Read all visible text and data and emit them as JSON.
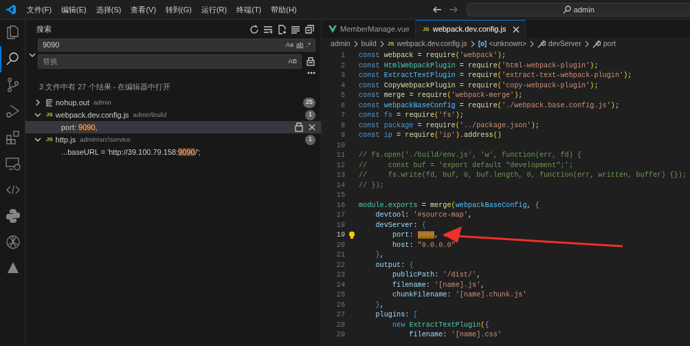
{
  "menu": [
    "文件(F)",
    "编辑(E)",
    "选择(S)",
    "查看(V)",
    "转到(G)",
    "运行(R)",
    "终端(T)",
    "帮助(H)"
  ],
  "command_center": {
    "value": "admin"
  },
  "activity_bar": [
    {
      "selected": false
    },
    {
      "selected": true
    },
    {
      "selected": false
    },
    {
      "selected": false
    },
    {
      "selected": false
    },
    {
      "selected": false
    },
    {
      "selected": false
    },
    {
      "selected": false
    },
    {
      "selected": false
    },
    {
      "selected": false
    }
  ],
  "sidebar": {
    "title": "搜索",
    "search": {
      "value": "9090",
      "options": [
        "Aa",
        "ab",
        ".*"
      ]
    },
    "replace_expanded": true,
    "replace": {
      "placeholder": "替换",
      "option": "AB"
    },
    "summary": "3 文件中有 27 个结果 - ",
    "summary_link": "在编辑器中打开",
    "results": [
      {
        "kind": "text",
        "name": "nohup.out",
        "path": "admin",
        "count": "25",
        "expanded": false
      },
      {
        "kind": "js",
        "badge": "JS",
        "name": "webpack.dev.config.js",
        "path": "admin\\build",
        "count": "1",
        "expanded": true,
        "children": [
          {
            "before": "port: ",
            "match": "9090",
            "after": ",",
            "selected": true
          }
        ]
      },
      {
        "kind": "js",
        "badge": "JS",
        "name": "http.js",
        "path": "admin\\src\\service",
        "count": "1",
        "expanded": true,
        "children": [
          {
            "before": "...baseURL = 'http://39.100.79.158:",
            "match": "9090",
            "after": "/';",
            "selected": false
          }
        ]
      }
    ]
  },
  "tabs": [
    {
      "kind": "vue",
      "label": "MemberManage.vue",
      "selected": false
    },
    {
      "kind": "js",
      "badge": "JS",
      "label": "webpack.dev.config.js",
      "selected": true
    }
  ],
  "breadcrumb": [
    {
      "kind": "folder",
      "label": "admin"
    },
    {
      "kind": "folder",
      "label": "build"
    },
    {
      "kind": "js",
      "badge": "JS",
      "label": "webpack.dev.config.js"
    },
    {
      "kind": "object",
      "label": "<unknown>"
    },
    {
      "kind": "property",
      "label": "devServer"
    },
    {
      "kind": "property",
      "label": "port"
    }
  ],
  "editor": {
    "lines": [
      {
        "number": "1",
        "current": false,
        "tokens": [
          {
            "text": "const ",
            "kind": "kw"
          },
          {
            "text": "webpack",
            "kind": "plain"
          },
          {
            "text": " = ",
            "kind": "punct"
          },
          {
            "text": "require",
            "kind": "func"
          },
          {
            "text": "(",
            "kind": "br1"
          },
          {
            "text": "'webpack'",
            "kind": "str"
          },
          {
            "text": ")",
            "kind": "br1"
          },
          {
            "text": ";",
            "kind": "punct"
          }
        ]
      },
      {
        "number": "2",
        "current": false,
        "tokens": [
          {
            "text": "const ",
            "kind": "kw"
          },
          {
            "text": "HtmlWebpackPlugin",
            "kind": "class"
          },
          {
            "text": " = ",
            "kind": "punct"
          },
          {
            "text": "require",
            "kind": "func"
          },
          {
            "text": "(",
            "kind": "br1"
          },
          {
            "text": "'html-webpack-plugin'",
            "kind": "str"
          },
          {
            "text": ")",
            "kind": "br1"
          },
          {
            "text": ";",
            "kind": "punct"
          }
        ]
      },
      {
        "number": "3",
        "current": false,
        "tokens": [
          {
            "text": "const ",
            "kind": "kw"
          },
          {
            "text": "ExtractTextPlugin",
            "kind": "const"
          },
          {
            "text": " = ",
            "kind": "punct"
          },
          {
            "text": "require",
            "kind": "func"
          },
          {
            "text": "(",
            "kind": "br1"
          },
          {
            "text": "'extract-text-webpack-plugin'",
            "kind": "str"
          },
          {
            "text": ")",
            "kind": "br1"
          },
          {
            "text": ";",
            "kind": "punct"
          }
        ]
      },
      {
        "number": "4",
        "current": false,
        "tokens": [
          {
            "text": "const ",
            "kind": "kw"
          },
          {
            "text": "CopyWebpackPlugin",
            "kind": "plain"
          },
          {
            "text": " = ",
            "kind": "punct"
          },
          {
            "text": "require",
            "kind": "func"
          },
          {
            "text": "(",
            "kind": "br1"
          },
          {
            "text": "'copy-webpack-plugin'",
            "kind": "str"
          },
          {
            "text": ")",
            "kind": "br1"
          },
          {
            "text": ";",
            "kind": "punct"
          }
        ]
      },
      {
        "number": "5",
        "current": false,
        "tokens": [
          {
            "text": "const ",
            "kind": "kw"
          },
          {
            "text": "merge",
            "kind": "plain"
          },
          {
            "text": " = ",
            "kind": "punct"
          },
          {
            "text": "require",
            "kind": "func"
          },
          {
            "text": "(",
            "kind": "br1"
          },
          {
            "text": "'webpack-merge'",
            "kind": "str"
          },
          {
            "text": ")",
            "kind": "br1"
          },
          {
            "text": ";",
            "kind": "punct"
          }
        ]
      },
      {
        "number": "6",
        "current": false,
        "tokens": [
          {
            "text": "const ",
            "kind": "kw"
          },
          {
            "text": "webpackBaseConfig",
            "kind": "const"
          },
          {
            "text": " = ",
            "kind": "punct"
          },
          {
            "text": "require",
            "kind": "func"
          },
          {
            "text": "(",
            "kind": "br1"
          },
          {
            "text": "'./webpack.base.config.js'",
            "kind": "str"
          },
          {
            "text": ")",
            "kind": "br1"
          },
          {
            "text": ";",
            "kind": "punct"
          }
        ]
      },
      {
        "number": "7",
        "current": false,
        "tokens": [
          {
            "text": "const ",
            "kind": "kw"
          },
          {
            "text": "fs",
            "kind": "var"
          },
          {
            "text": " = ",
            "kind": "punct"
          },
          {
            "text": "require",
            "kind": "func"
          },
          {
            "text": "(",
            "kind": "br1"
          },
          {
            "text": "'fs'",
            "kind": "str"
          },
          {
            "text": ")",
            "kind": "br1"
          },
          {
            "text": ";",
            "kind": "punct"
          }
        ]
      },
      {
        "number": "8",
        "current": false,
        "tokens": [
          {
            "text": "const ",
            "kind": "kw"
          },
          {
            "text": "package",
            "kind": "var"
          },
          {
            "text": " = ",
            "kind": "punct"
          },
          {
            "text": "require",
            "kind": "func"
          },
          {
            "text": "(",
            "kind": "br1"
          },
          {
            "text": "'../package.json'",
            "kind": "str"
          },
          {
            "text": ")",
            "kind": "br1"
          },
          {
            "text": ";",
            "kind": "punct"
          }
        ]
      },
      {
        "number": "9",
        "current": false,
        "tokens": [
          {
            "text": "const ",
            "kind": "kw"
          },
          {
            "text": "ip",
            "kind": "var"
          },
          {
            "text": " = ",
            "kind": "punct"
          },
          {
            "text": "require",
            "kind": "func"
          },
          {
            "text": "(",
            "kind": "br1"
          },
          {
            "text": "'ip'",
            "kind": "str"
          },
          {
            "text": ")",
            "kind": "br1"
          },
          {
            "text": ".",
            "kind": "punct"
          },
          {
            "text": "address",
            "kind": "func"
          },
          {
            "text": "()",
            "kind": "br1"
          }
        ]
      },
      {
        "number": "10",
        "current": false
      },
      {
        "number": "11",
        "current": false,
        "tokens": [
          {
            "text": "// fs.open('./build/env.js', 'w', function(err, fd) {",
            "kind": "comment"
          }
        ]
      },
      {
        "number": "12",
        "current": false,
        "tokens": [
          {
            "text": "//     const buf = 'export default \"development\";';",
            "kind": "comment"
          }
        ]
      },
      {
        "number": "13",
        "current": false,
        "tokens": [
          {
            "text": "//     fs.write(fd, buf, 0, buf.length, 0, function(err, written, buffer) {});",
            "kind": "comment"
          }
        ]
      },
      {
        "number": "14",
        "current": false,
        "tokens": [
          {
            "text": "// });",
            "kind": "comment"
          }
        ]
      },
      {
        "number": "15",
        "current": false
      },
      {
        "number": "16",
        "current": false,
        "tokens": [
          {
            "text": "module",
            "kind": "class"
          },
          {
            "text": ".",
            "kind": "punct"
          },
          {
            "text": "exports",
            "kind": "class"
          },
          {
            "text": " = ",
            "kind": "punct"
          },
          {
            "text": "merge",
            "kind": "func"
          },
          {
            "text": "(",
            "kind": "br1"
          },
          {
            "text": "webpackBaseConfig",
            "kind": "const"
          },
          {
            "text": ", ",
            "kind": "punct"
          },
          {
            "text": "{",
            "kind": "br2"
          }
        ]
      },
      {
        "number": "17",
        "current": false,
        "tokens": [
          {
            "text": "    devtool",
            "kind": "prop"
          },
          {
            "text": ": ",
            "kind": "punct"
          },
          {
            "text": "'#source-map'",
            "kind": "str"
          },
          {
            "text": ",",
            "kind": "punct"
          }
        ]
      },
      {
        "number": "18",
        "current": false,
        "tokens": [
          {
            "text": "    devServer",
            "kind": "prop"
          },
          {
            "text": ": ",
            "kind": "punct"
          },
          {
            "text": "{",
            "kind": "br3"
          }
        ]
      },
      {
        "number": "19",
        "current": true,
        "tokens": [
          {
            "text": "        port",
            "kind": "prop"
          },
          {
            "text": ": ",
            "kind": "punct"
          },
          {
            "text": "9090",
            "kind": "match"
          },
          {
            "text": ",",
            "kind": "punct"
          }
        ]
      },
      {
        "number": "20",
        "current": false,
        "tokens": [
          {
            "text": "        host",
            "kind": "prop"
          },
          {
            "text": ": ",
            "kind": "punct"
          },
          {
            "text": "\"0.0.0.0\"",
            "kind": "str"
          }
        ]
      },
      {
        "number": "21",
        "current": false,
        "tokens": [
          {
            "text": "    }",
            "kind": "br3"
          },
          {
            "text": ",",
            "kind": "punct"
          }
        ]
      },
      {
        "number": "22",
        "current": false,
        "tokens": [
          {
            "text": "    output",
            "kind": "prop"
          },
          {
            "text": ": ",
            "kind": "punct"
          },
          {
            "text": "{",
            "kind": "br3"
          }
        ]
      },
      {
        "number": "23",
        "current": false,
        "tokens": [
          {
            "text": "        publicPath",
            "kind": "prop"
          },
          {
            "text": ": ",
            "kind": "punct"
          },
          {
            "text": "'/dist/'",
            "kind": "str"
          },
          {
            "text": ",",
            "kind": "punct"
          }
        ]
      },
      {
        "number": "24",
        "current": false,
        "tokens": [
          {
            "text": "        filename",
            "kind": "prop"
          },
          {
            "text": ": ",
            "kind": "punct"
          },
          {
            "text": "'[name].js'",
            "kind": "str"
          },
          {
            "text": ",",
            "kind": "punct"
          }
        ]
      },
      {
        "number": "25",
        "current": false,
        "tokens": [
          {
            "text": "        chunkFilename",
            "kind": "prop"
          },
          {
            "text": ": ",
            "kind": "punct"
          },
          {
            "text": "'[name].chunk.js'",
            "kind": "str"
          }
        ]
      },
      {
        "number": "26",
        "current": false,
        "tokens": [
          {
            "text": "    }",
            "kind": "br3"
          },
          {
            "text": ",",
            "kind": "punct"
          }
        ]
      },
      {
        "number": "27",
        "current": false,
        "tokens": [
          {
            "text": "    plugins",
            "kind": "prop"
          },
          {
            "text": ": ",
            "kind": "punct"
          },
          {
            "text": "[",
            "kind": "br3"
          }
        ]
      },
      {
        "number": "28",
        "current": false,
        "tokens": [
          {
            "text": "        new ",
            "kind": "kw"
          },
          {
            "text": "ExtractTextPlugin",
            "kind": "class"
          },
          {
            "text": "(",
            "kind": "br1"
          },
          {
            "text": "{",
            "kind": "br2"
          }
        ]
      },
      {
        "number": "29",
        "current": false,
        "tokens": [
          {
            "text": "            filename",
            "kind": "prop"
          },
          {
            "text": ": ",
            "kind": "punct"
          },
          {
            "text": "'[name].css'",
            "kind": "str"
          }
        ]
      }
    ]
  }
}
